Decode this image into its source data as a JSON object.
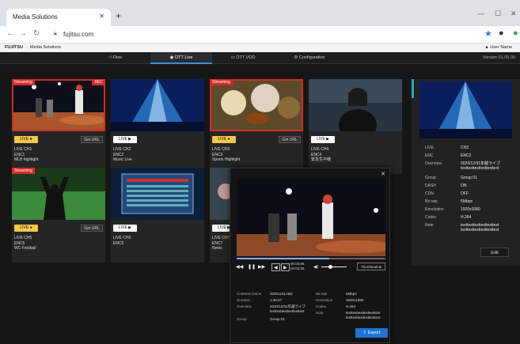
{
  "browser": {
    "tab_title": "Media Solutions",
    "tab_close": "✕",
    "new_tab": "+",
    "url": "fujitsu.com",
    "window_controls": [
      "—",
      "☐",
      "✕"
    ]
  },
  "app": {
    "brand": "FUJITSU",
    "name": "Media Solutions",
    "user": "User Name",
    "version": "Version 01.06.00"
  },
  "nav": {
    "tabs": [
      {
        "label": "Flow",
        "icon": "flow-icon"
      },
      {
        "label": "OTT Live",
        "icon": "live-icon"
      },
      {
        "label": "OTT VOD",
        "icon": "vod-icon"
      },
      {
        "label": "Configuration",
        "icon": "gear-icon"
      }
    ]
  },
  "cards": [
    {
      "badge": "Streaming",
      "rec": "REC",
      "live": "LIVE ●",
      "get_url": "Get URL",
      "line1": "LIVE CH1",
      "line2": "ENC1",
      "line3": "MLB highlight"
    },
    {
      "badge": "",
      "rec": "",
      "live": "LIVE ▶",
      "get_url": "",
      "line1": "LIVE CH2",
      "line2": "ENC2",
      "line3": "Music Live"
    },
    {
      "badge": "Streaming",
      "rec": "",
      "live": "LIVE ●",
      "get_url": "Get URL",
      "line1": "LIVE CH3",
      "line2": "ENC3",
      "line3": "Sports Highlight"
    },
    {
      "badge": "",
      "rec": "",
      "live": "LIVE ▶",
      "get_url": "",
      "line1": "LIVE CH4",
      "line2": "ENC4",
      "line3": "緊急生中継"
    },
    {
      "badge": "Streaming",
      "rec": "",
      "live": "LIVE ●",
      "get_url": "Get URL",
      "line1": "LIVE CH5",
      "line2": "ENC5",
      "line3": "WC Football"
    },
    {
      "badge": "",
      "rec": "",
      "live": "LIVE ▶",
      "get_url": "",
      "line1": "LIVE CH6",
      "line2": "ENC6",
      "line3": ""
    },
    {
      "badge": "",
      "rec": "",
      "live": "LIVE ▶",
      "get_url": "",
      "line1": "LIVE CH7",
      "line2": "ENC7",
      "line3": "News"
    }
  ],
  "detail": {
    "rows": [
      {
        "label": "LIVE",
        "value": "CH2"
      },
      {
        "label": "ENC",
        "value": "ENC2"
      },
      {
        "label": "Overview",
        "value": "2020/12/31年越ライブ texttexttexttexttexttext"
      },
      {
        "label": "Group",
        "value": "Group 01"
      },
      {
        "label": "DASH",
        "value": "ON"
      },
      {
        "label": "CDN",
        "value": "OFF"
      },
      {
        "label": "Bit rate",
        "value": "5Mbps"
      },
      {
        "label": "Resolution",
        "value": "1920x1080"
      },
      {
        "label": "Codec",
        "value": "H.264"
      },
      {
        "label": "Note",
        "value": "texttexttexttexttexttext texttexttexttexttexttext"
      }
    ],
    "edit": "Edit"
  },
  "modal": {
    "close": "✕",
    "progress": 0.62,
    "volume": 0.35,
    "timecode_in": "00:03:06",
    "timecode_out": "00:03:06",
    "thumbnail": "Thumbnail ⊕",
    "info_left": [
      {
        "label": "Contents Name",
        "value": "20201231ABC"
      },
      {
        "label": "Duration",
        "value": "1:46:27"
      },
      {
        "label": "Overview",
        "value": "2020/12/31年越ライブ texttexttexttexttexttext"
      },
      {
        "label": "Group",
        "value": "Group 01"
      }
    ],
    "info_right": [
      {
        "label": "Bit rate",
        "value": "4Mbps"
      },
      {
        "label": "Resolution",
        "value": "1920x1080"
      },
      {
        "label": "Codec",
        "value": "H.264"
      },
      {
        "label": "Note",
        "value": "texttexttexttexttexttext texttexttexttexttexttext"
      }
    ],
    "export": "Export"
  },
  "colors": {
    "accent": "#1f74d4",
    "streaming": "#d62b2b",
    "live": "#f2c94c",
    "panel": "#161616"
  }
}
